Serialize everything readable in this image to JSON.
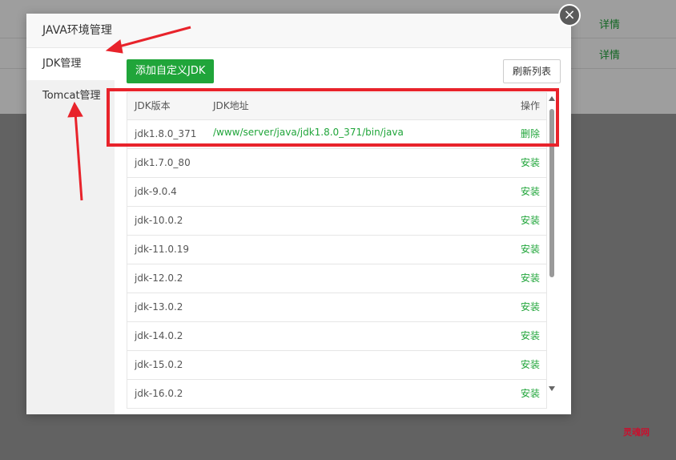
{
  "background": {
    "rows": [
      {
        "link": "详情"
      },
      {
        "link": "详情"
      }
    ]
  },
  "watermark": "灵魂网",
  "modal": {
    "title": "JAVA环境管理",
    "close_icon": "×",
    "sidebar": [
      {
        "label": "JDK管理",
        "active": true
      },
      {
        "label": "Tomcat管理",
        "active": false
      }
    ],
    "toolbar": {
      "add_button": "添加自定义JDK",
      "refresh_button": "刷新列表"
    },
    "table": {
      "headers": {
        "version": "JDK版本",
        "path": "JDK地址",
        "action": "操作"
      },
      "rows": [
        {
          "version": "jdk1.8.0_371",
          "path": "/www/server/java/jdk1.8.0_371/bin/java",
          "action": "删除"
        },
        {
          "version": "jdk1.7.0_80",
          "path": "",
          "action": "安装"
        },
        {
          "version": "jdk-9.0.4",
          "path": "",
          "action": "安装"
        },
        {
          "version": "jdk-10.0.2",
          "path": "",
          "action": "安装"
        },
        {
          "version": "jdk-11.0.19",
          "path": "",
          "action": "安装"
        },
        {
          "version": "jdk-12.0.2",
          "path": "",
          "action": "安装"
        },
        {
          "version": "jdk-13.0.2",
          "path": "",
          "action": "安装"
        },
        {
          "version": "jdk-14.0.2",
          "path": "",
          "action": "安装"
        },
        {
          "version": "jdk-15.0.2",
          "path": "",
          "action": "安装"
        },
        {
          "version": "jdk-16.0.2",
          "path": "",
          "action": "安装"
        }
      ]
    }
  },
  "colors": {
    "accent": "#20a53a",
    "annotation": "#e8232b"
  }
}
